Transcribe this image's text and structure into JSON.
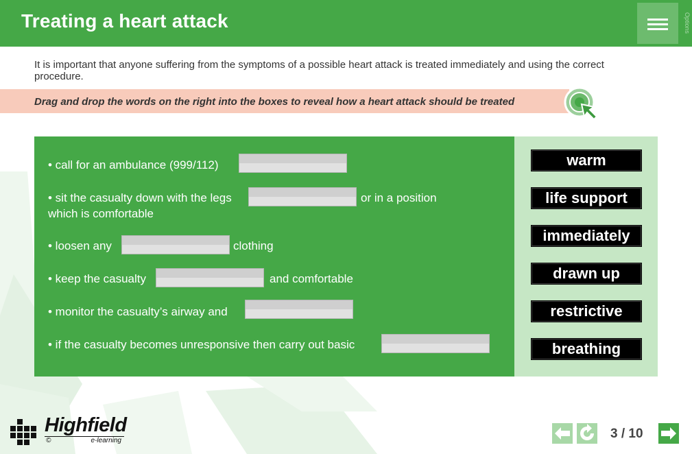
{
  "header": {
    "title": "Treating a heart attack",
    "options_label": "Options"
  },
  "intro": "It is important that anyone suffering from the symptoms of a possible heart attack is treated immediately and using the correct procedure.",
  "instruction": "Drag and drop the words on the right into the boxes to reveal how a heart attack should be treated",
  "statements": {
    "s1": {
      "before": "• call for an ambulance (999/112)"
    },
    "s2": {
      "before": "• sit the casualty down with the legs",
      "after": "or in a position",
      "line2": "which is comfortable"
    },
    "s3": {
      "before": "• loosen any",
      "after": "clothing"
    },
    "s4": {
      "before": "• keep the casualty",
      "after": "and comfortable"
    },
    "s5": {
      "before": "• monitor the casualty’s airway and"
    },
    "s6": {
      "before": "• if the casualty becomes unresponsive then carry out basic"
    }
  },
  "words": [
    "warm",
    "life support",
    "immediately",
    "drawn up",
    "restrictive",
    "breathing"
  ],
  "logo": {
    "name": "Highfield",
    "copyright": "©",
    "subtitle": "e-learning"
  },
  "navigation": {
    "page_count": "3 / 10"
  },
  "colors": {
    "brand_green": "#45a847",
    "light_green": "#c6e7c5",
    "instruction_bg": "#f8cbbb"
  }
}
